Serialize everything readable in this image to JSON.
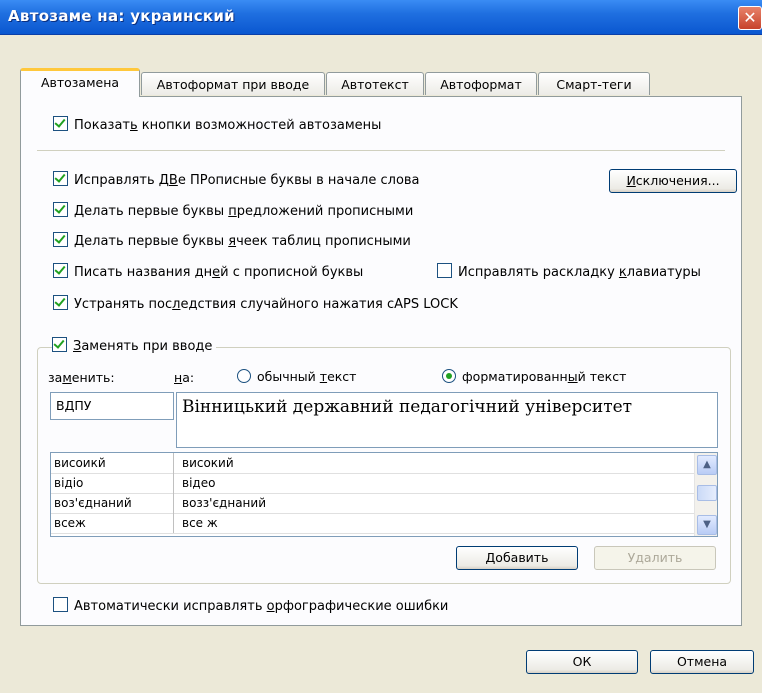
{
  "window": {
    "title": "Автозаме на: украинский",
    "close_glyph": "✕"
  },
  "tabs": [
    {
      "label": "Автозамена",
      "active": true
    },
    {
      "label": "Автоформат при вводе",
      "active": false
    },
    {
      "label": "Автотекст",
      "active": false
    },
    {
      "label": "Автоформат",
      "active": false
    },
    {
      "label": "Смарт-теги",
      "active": false
    }
  ],
  "options": {
    "show_buttons": {
      "pre": "Показат",
      "u": "ь",
      "post": " кнопки возможностей автозамены",
      "checked": true
    },
    "two_caps": {
      "pre": "Исправлять Д",
      "u": "В",
      "post": "е ПРописные буквы в начале слова",
      "checked": true
    },
    "sentence_caps": {
      "pre": "Делать первые буквы ",
      "u": "п",
      "post": "редложений прописными",
      "checked": true
    },
    "cell_caps": {
      "pre": "Делать первые буквы ",
      "u": "я",
      "post": "чеек таблиц прописными",
      "checked": true
    },
    "day_names": {
      "pre": "Писать названия дн",
      "u": "е",
      "post": "й с прописной буквы",
      "checked": true
    },
    "keyboard_layout": {
      "pre": "Исправлять раскладку ",
      "u": "к",
      "post": "лавиатуры",
      "checked": false
    },
    "caps_lock": {
      "pre": "Устранять пос",
      "u": "л",
      "post": "едствия случайного нажатия cAPS LOCK",
      "checked": true
    },
    "replace_typing": {
      "pre": "",
      "u": "З",
      "post": "аменять при вводе",
      "checked": true
    },
    "spelling": {
      "pre": "Автоматически исправлять ",
      "u": "о",
      "post": "рфографические ошибки",
      "checked": false
    }
  },
  "buttons": {
    "exceptions": {
      "u": "И",
      "post": "сключения..."
    },
    "add": {
      "u": "Д",
      "post": "обавить"
    },
    "delete": "Удалить",
    "ok": "ОК",
    "cancel": "Отмена"
  },
  "replace": {
    "replace_label": {
      "pre": "за",
      "u": "м",
      "post": "енить:"
    },
    "with_label": {
      "pre": "",
      "u": "н",
      "post": "а:"
    },
    "plain_text": {
      "pre": "обычный ",
      "u": "т",
      "post": "екст",
      "selected": false
    },
    "formatted_text": {
      "pre": "форматированн",
      "u": "ы",
      "post": "й текст",
      "selected": true
    },
    "replace_value": "ВДПУ",
    "with_value": "Вінницький державний педагогічний університет"
  },
  "entries": [
    {
      "from": "висоикй",
      "to": "високий"
    },
    {
      "from": "відіо",
      "to": "відео"
    },
    {
      "from": "воз'єднаний",
      "to": "возз'єднаний"
    },
    {
      "from": "всеж",
      "to": "все ж"
    }
  ],
  "scroll_glyphs": {
    "up": "▲",
    "down": "▼"
  }
}
